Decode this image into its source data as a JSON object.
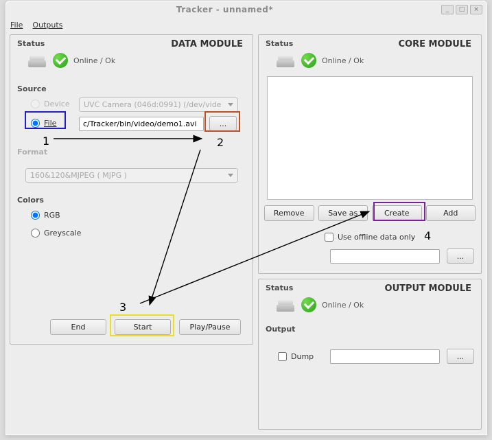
{
  "window": {
    "title": "Tracker - unnamed*",
    "minimize": "_",
    "maximize": "□",
    "close": "×"
  },
  "menubar": {
    "file": "File",
    "outputs": "Outputs"
  },
  "data_module": {
    "title": "DATA MODULE",
    "status_label": "Status",
    "status_text": "Online / Ok",
    "source_label": "Source",
    "device_label": "Device",
    "device_value": "UVC Camera (046d:0991) (/dev/vide",
    "file_label": "File",
    "file_value": "c/Tracker/bin/video/demo1.avi",
    "browse": "...",
    "format_label": "Format",
    "format_value": "160&120&MJPEG ( MJPG )",
    "colors_label": "Colors",
    "color_rgb": "RGB",
    "color_grey": "Greyscale",
    "btn_end": "End",
    "btn_start": "Start",
    "btn_play": "Play/Pause"
  },
  "core_module": {
    "title": "CORE MODULE",
    "status_label": "Status",
    "status_text": "Online / Ok",
    "btn_remove": "Remove",
    "btn_saveas": "Save as",
    "btn_create": "Create",
    "btn_add": "Add",
    "use_offline": "Use offline data only",
    "browse": "..."
  },
  "output_module": {
    "title": "OUTPUT MODULE",
    "status_label": "Status",
    "status_text": "Online / Ok",
    "output_label": "Output",
    "dump_label": "Dump",
    "browse": "..."
  },
  "annotations": {
    "n1": "1",
    "n2": "2",
    "n3": "3",
    "n4": "4"
  }
}
